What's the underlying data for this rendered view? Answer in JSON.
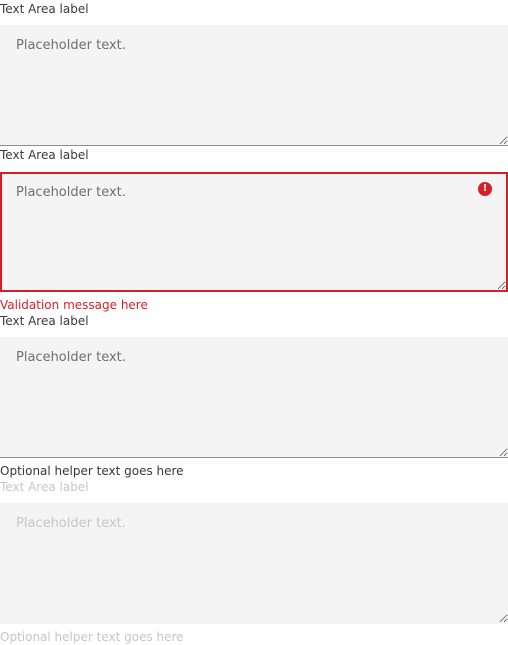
{
  "fields": [
    {
      "label": "Text Area label",
      "placeholder": "Placeholder text."
    },
    {
      "label": "Text Area label",
      "placeholder": "Placeholder text.",
      "validation_message": "Validation message here",
      "icon": "warning-filled-icon"
    },
    {
      "label": "Text Area label",
      "placeholder": "Placeholder text.",
      "helper_text": "Optional helper text goes here"
    },
    {
      "label": "Text Area label",
      "placeholder": "Placeholder text.",
      "helper_text": "Optional helper text goes here",
      "state": "disabled"
    }
  ],
  "colors": {
    "field_background": "#f4f4f4",
    "error": "#da1e28",
    "label": "#393939",
    "placeholder": "#6f6f6f",
    "disabled": "#c6c6c6"
  }
}
